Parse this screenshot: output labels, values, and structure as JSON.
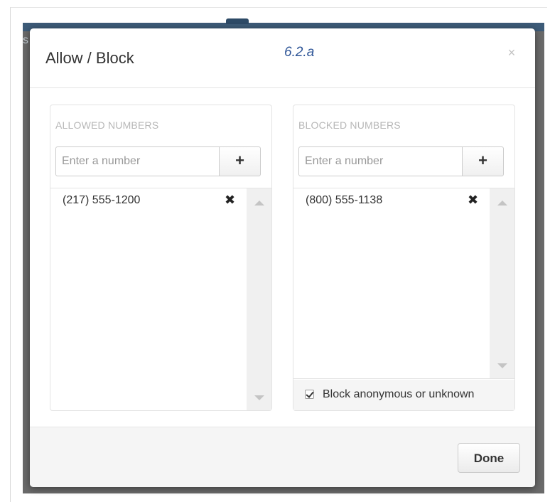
{
  "background": {
    "partial_char": "s"
  },
  "modal": {
    "title": "Allow / Block",
    "annotation": "6.2.a",
    "close_glyph": "×"
  },
  "allowed": {
    "title": "ALLOWED NUMBERS",
    "input_placeholder": "Enter a number",
    "input_value": "",
    "add_glyph": "+",
    "items": [
      {
        "number": "(217) 555-1200"
      }
    ]
  },
  "blocked": {
    "title": "BLOCKED NUMBERS",
    "input_placeholder": "Enter a number",
    "input_value": "",
    "add_glyph": "+",
    "items": [
      {
        "number": "(800) 555-1138"
      }
    ],
    "block_anonymous": {
      "label": "Block anonymous or unknown",
      "checked": true
    }
  },
  "footer": {
    "done_label": "Done"
  },
  "icons": {
    "remove": "✖",
    "close": "close-icon",
    "add": "plus-icon"
  },
  "colors": {
    "annotation": "#2e5597",
    "header_strip": "#3d5b78",
    "overlay": "#6a6a6a"
  }
}
